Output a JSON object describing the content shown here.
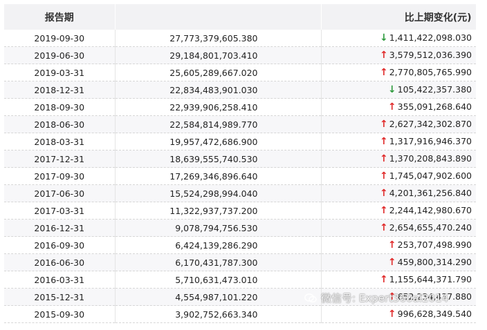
{
  "table": {
    "headers": [
      "报告期",
      "",
      "比上期变化(元)"
    ],
    "rows": [
      {
        "date": "2019-09-30",
        "value": "27,773,379,605.380",
        "direction": "down",
        "change": "1,411,422,098.030"
      },
      {
        "date": "2019-06-30",
        "value": "29,184,801,703.410",
        "direction": "up",
        "change": "3,579,512,036.390"
      },
      {
        "date": "2019-03-31",
        "value": "25,605,289,667.020",
        "direction": "up",
        "change": "2,770,805,765.990"
      },
      {
        "date": "2018-12-31",
        "value": "22,834,483,901.030",
        "direction": "down",
        "change": "105,422,357.380"
      },
      {
        "date": "2018-09-30",
        "value": "22,939,906,258.410",
        "direction": "up",
        "change": "355,091,268.640"
      },
      {
        "date": "2018-06-30",
        "value": "22,584,814,989.770",
        "direction": "up",
        "change": "2,627,342,302.870"
      },
      {
        "date": "2018-03-31",
        "value": "19,957,472,686.900",
        "direction": "up",
        "change": "1,317,916,946.370"
      },
      {
        "date": "2017-12-31",
        "value": "18,639,555,740.530",
        "direction": "up",
        "change": "1,370,208,843.890"
      },
      {
        "date": "2017-09-30",
        "value": "17,269,346,896.640",
        "direction": "up",
        "change": "1,745,047,902.600"
      },
      {
        "date": "2017-06-30",
        "value": "15,524,298,994.040",
        "direction": "up",
        "change": "4,201,361,256.840"
      },
      {
        "date": "2017-03-31",
        "value": "11,322,937,737.200",
        "direction": "up",
        "change": "2,244,142,980.670"
      },
      {
        "date": "2016-12-31",
        "value": "9,078,794,756.530",
        "direction": "up",
        "change": "2,654,655,470.240"
      },
      {
        "date": "2016-09-30",
        "value": "6,424,139,286.290",
        "direction": "up",
        "change": "253,707,498.990"
      },
      {
        "date": "2016-06-30",
        "value": "6,170,431,787.300",
        "direction": "up",
        "change": "459,800,314.290"
      },
      {
        "date": "2016-03-31",
        "value": "5,710,631,473.010",
        "direction": "up",
        "change": "1,155,644,371.790"
      },
      {
        "date": "2015-12-31",
        "value": "4,554,987,101.220",
        "direction": "up",
        "change": "652,234,437.880"
      },
      {
        "date": "2015-09-30",
        "value": "3,902,752,663.340",
        "direction": "up",
        "change": "996,628,349.540"
      }
    ]
  },
  "arrows": {
    "up": "↑",
    "down": "↓"
  },
  "colors": {
    "up": "#e02b2b",
    "down": "#2e9a3d",
    "header_bg": "#f2f2f4"
  },
  "watermark": {
    "text": "微信号: Expert360al2014",
    "icon": "wechat-icon"
  }
}
